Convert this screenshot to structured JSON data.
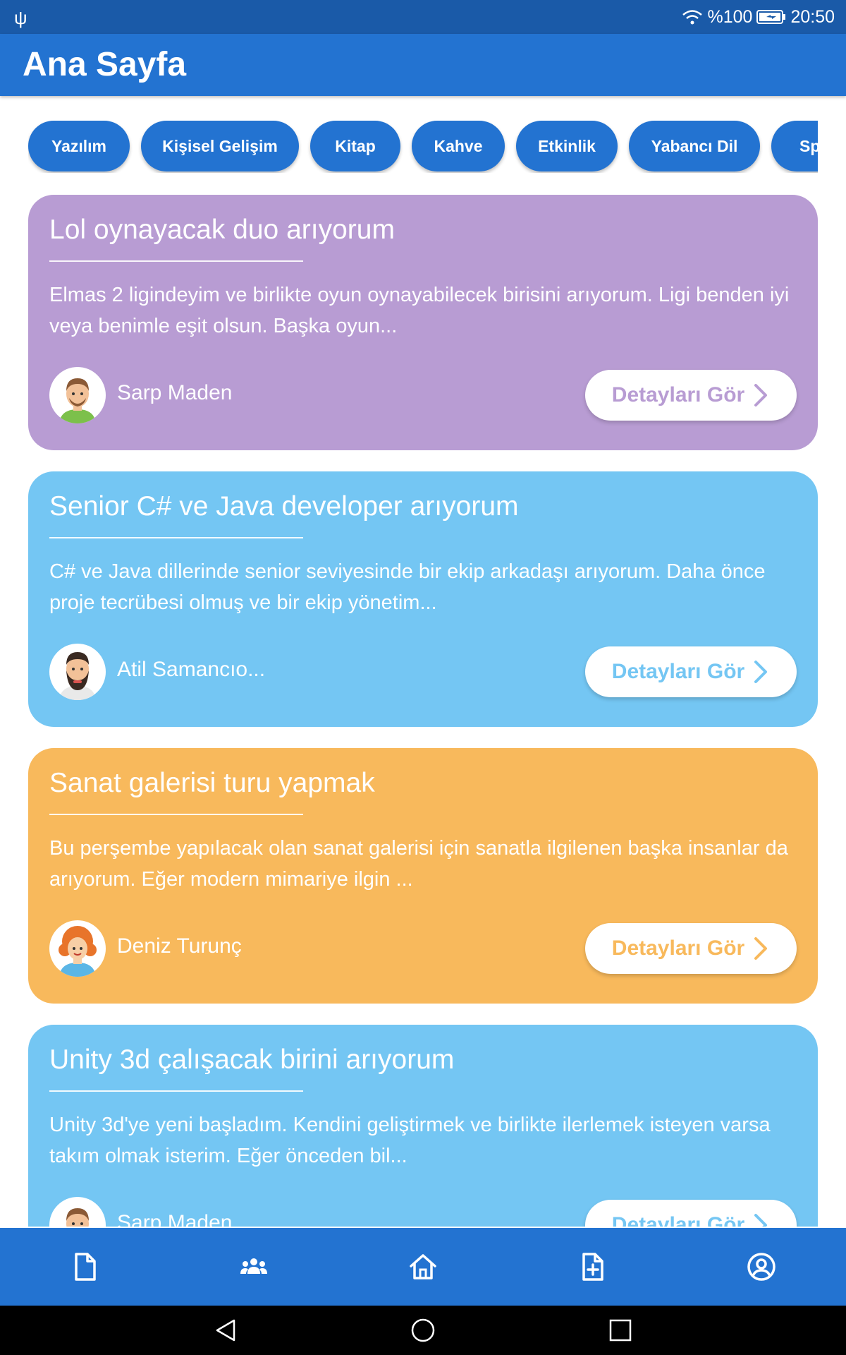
{
  "status_bar": {
    "signal": "%100",
    "time": "20:50"
  },
  "app_bar": {
    "title": "Ana Sayfa"
  },
  "categories": [
    "Yazılım",
    "Kişisel Gelişim",
    "Kitap",
    "Kahve",
    "Etkinlik",
    "Yabancı Dil",
    "Sp"
  ],
  "cards": [
    {
      "title": "Lol oynayacak duo arıyorum",
      "description": "Elmas 2 ligindeyim ve birlikte oyun oynayabilecek birisini arıyorum. Ligi benden iyi veya benimle eşit olsun. Başka oyun...",
      "author": "Sarp Maden",
      "button_label": "Detayları Gör",
      "color": "#b89cd3",
      "avatar_icon": "man-avatar-icon"
    },
    {
      "title": "Senior C# ve Java developer arıyorum",
      "description": "C# ve Java dillerinde senior seviyesinde bir ekip arkadaşı arıyorum. Daha önce proje tecrübesi olmuş ve bir ekip yönetim...",
      "author": "Atil Samancıo...",
      "button_label": "Detayları Gör",
      "color": "#74c6f3",
      "avatar_icon": "bearded-man-avatar-icon"
    },
    {
      "title": "Sanat galerisi turu yapmak",
      "description": "Bu perşembe yapılacak olan sanat galerisi için sanatla ilgilenen başka insanlar da arıyorum. Eğer modern mimariye ilgin ...",
      "author": "Deniz Turunç",
      "button_label": "Detayları Gör",
      "color": "#f8b95c",
      "avatar_icon": "girl-avatar-icon"
    },
    {
      "title": "Unity 3d çalışacak birini arıyorum",
      "description": "Unity 3d'ye yeni başladım. Kendini geliştirmek ve birlikte ilerlemek isteyen varsa takım olmak isterim. Eğer önceden bil...",
      "author": "Sarp Maden",
      "button_label": "Detayları Gör",
      "color": "#74c6f3",
      "avatar_icon": "man-avatar-icon"
    }
  ],
  "bottom_nav": [
    "document-icon",
    "people-icon",
    "home-icon",
    "add-document-icon",
    "profile-icon"
  ],
  "colors": {
    "primary": "#2373d1",
    "status_bar": "#1a5aa8"
  }
}
